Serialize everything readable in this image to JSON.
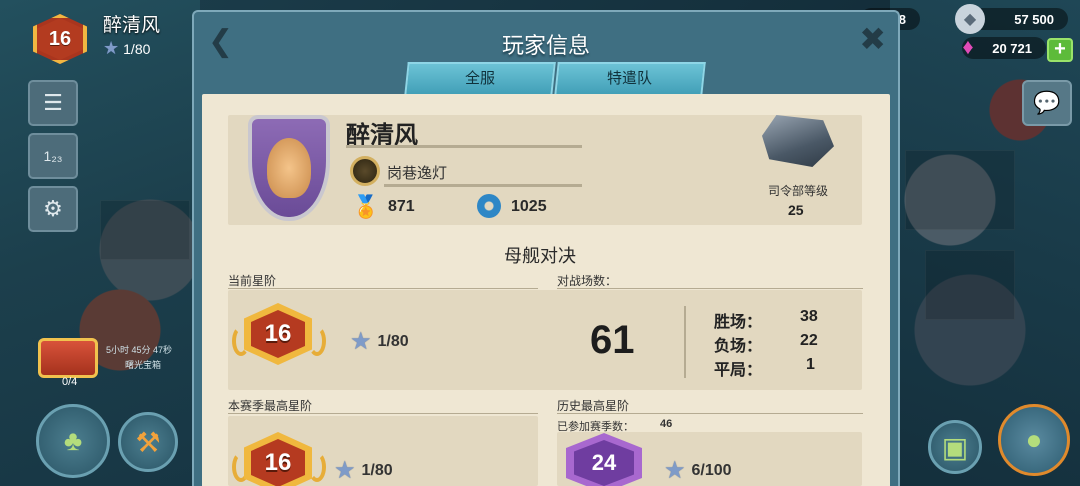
{
  "hud": {
    "level": "16",
    "player_name": "醉清风",
    "stars": "1/80",
    "chest_timer": "5小时 45分 47秒",
    "chest_label": "曙光宝箱",
    "chest_count": "0/4"
  },
  "resources": {
    "partial_value": "8",
    "crystals": "57 500",
    "gems": "20 721",
    "plus_label": "+"
  },
  "dialog": {
    "title": "玩家信息",
    "tabs": [
      {
        "label": "全服"
      },
      {
        "label": "特遣队"
      }
    ]
  },
  "profile": {
    "name": "醉清风",
    "guild": "岗巷逸灯",
    "medals": "871",
    "gears": "1025",
    "hq_label": "司令部等级",
    "hq_level": "25"
  },
  "mothership": {
    "section_title": "母舰对决",
    "current_rank_label": "当前星阶",
    "current_rank": "16",
    "current_stars": "1/80",
    "battles_label": "对战场数：",
    "battles": "61",
    "wins_label": "胜场：",
    "wins": "38",
    "losses_label": "负场：",
    "losses": "22",
    "draws_label": "平局：",
    "draws": "1",
    "season_best_label": "本赛季最高星阶",
    "season_best_rank": "16",
    "season_best_stars": "1/80",
    "history_best_label": "历史最高星阶",
    "seasons_joined_label": "已参加赛季数：",
    "seasons_joined": "46",
    "history_best_rank": "24",
    "history_best_stars": "6/100"
  },
  "colors": {
    "dialog_blue": "#3f6f82",
    "tab_cyan": "#6cc3d6",
    "paper": "#efe7d3",
    "card": "#e2d8c0",
    "rank_gold": "#f0b83e",
    "rank_red": "#b53a20",
    "rank_purple": "#6f3da0"
  }
}
